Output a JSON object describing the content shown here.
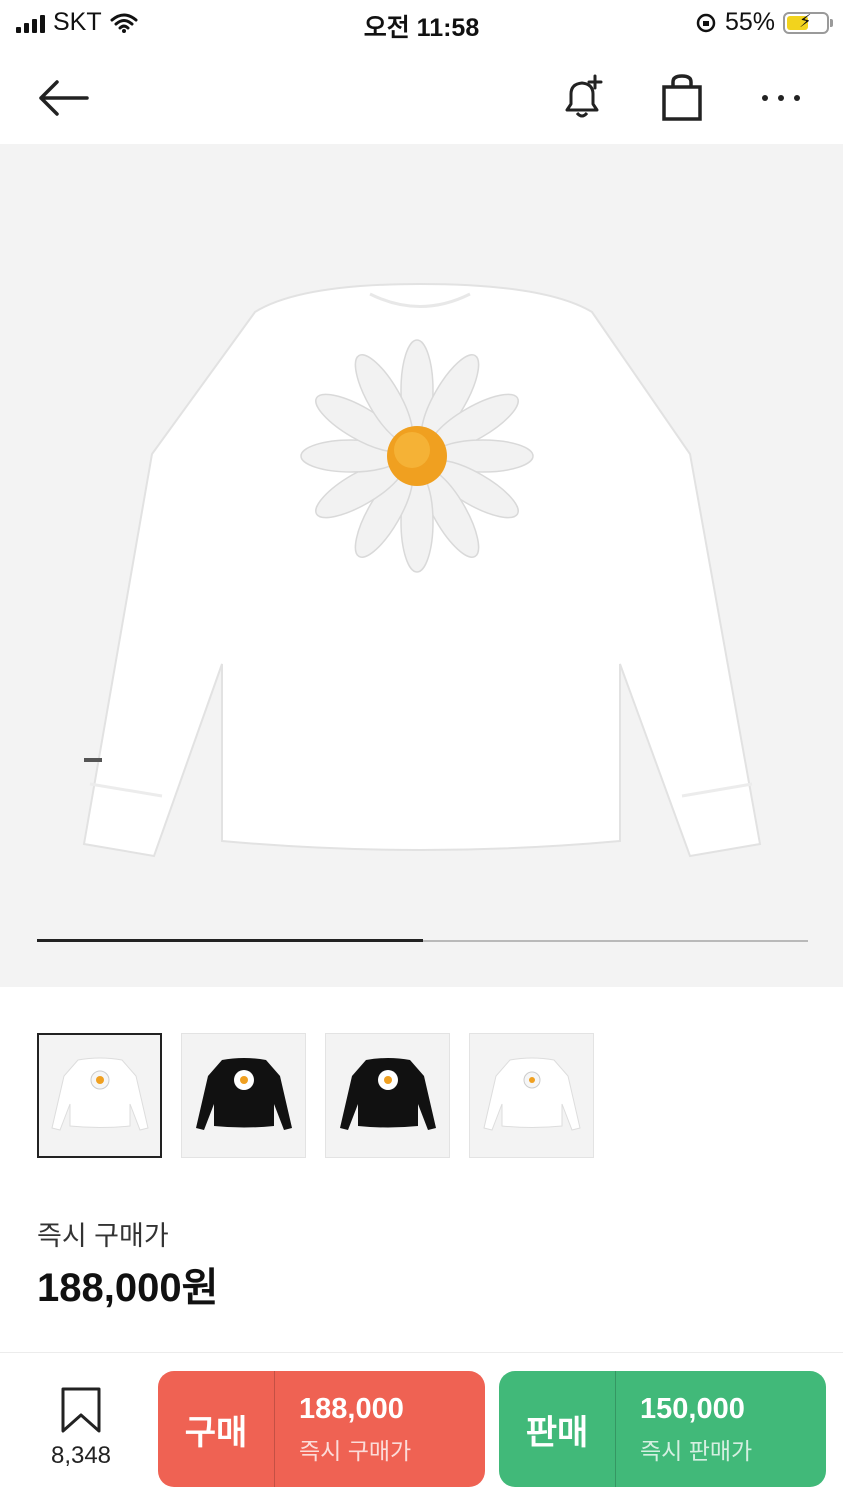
{
  "status_bar": {
    "carrier": "SKT",
    "time": "오전 11:58",
    "battery_percent": "55%",
    "battery_level": 0.55
  },
  "nav": {
    "icons": [
      "back-arrow-icon",
      "bell-plus-icon",
      "shopping-bag-icon",
      "more-icon"
    ]
  },
  "gallery": {
    "current_image": 1,
    "total_images": 2,
    "progress_fraction": 0.5,
    "thumbnails": [
      {
        "color": "white",
        "selected": true
      },
      {
        "color": "black",
        "selected": false
      },
      {
        "color": "black",
        "selected": false
      },
      {
        "color": "white",
        "selected": false
      }
    ]
  },
  "price": {
    "label": "즉시 구매가",
    "value": "188,000원"
  },
  "bottom_bar": {
    "wish_count": "8,348",
    "buy": {
      "tag": "구매",
      "amount": "188,000",
      "sub": "즉시 구매가",
      "color": "#ef6253"
    },
    "sell": {
      "tag": "판매",
      "amount": "150,000",
      "sub": "즉시 판매가",
      "color": "#41b979"
    }
  }
}
